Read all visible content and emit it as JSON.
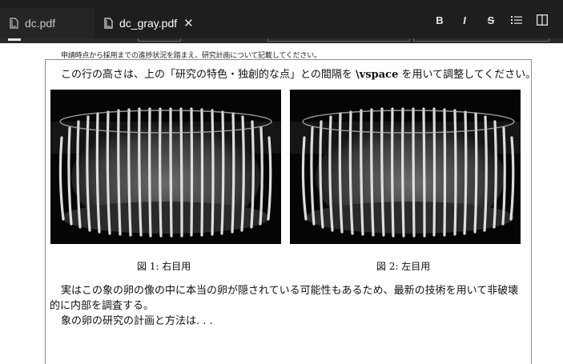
{
  "tabs": [
    {
      "label": "dc.pdf",
      "icon": "file-icon"
    },
    {
      "label": "dc_gray.pdf",
      "icon": "file-icon",
      "close": "✕"
    }
  ],
  "toolbar": {
    "bold": "B",
    "italic": "I",
    "strike": "S",
    "list_icon": "list-icon",
    "split_icon": "split-view-icon"
  },
  "document": {
    "instruction": "申請時点から採用までの進捗状況を踏まえ、研究計画について記載してください。",
    "lead_before": "この行の高さは、上の「研究の特色・独創的な点」との間隔を ",
    "lead_cmd": "\\vspace",
    "lead_after": " を用いて調整してください。",
    "figure1_caption": "図 1: 右目用",
    "figure2_caption": "図 2: 左目用",
    "para1": "実はこの象の卵の像の中に本当の卵が隠されている可能性もあるため、最新の技術を用いて非破壊的に内部を調査する。",
    "para2": "象の卵の研究の計画と方法は. . ."
  },
  "colors": {
    "tabbar_bg": "#1f1f1f",
    "tab_active_bg": "#1e1e1e",
    "page_bg": "#ffffff"
  }
}
